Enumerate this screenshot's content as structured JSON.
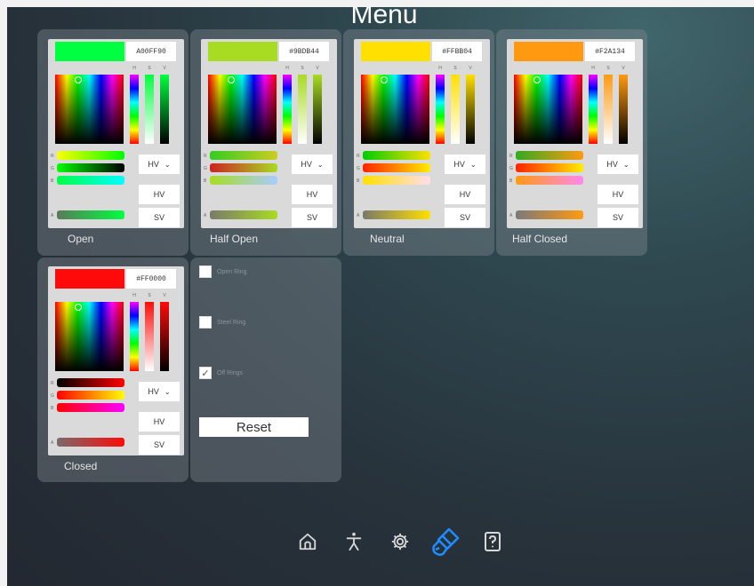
{
  "window": {
    "title": "Menu"
  },
  "pickers": [
    {
      "label": "Open",
      "hex": "A00FF90",
      "color": "#00ff40",
      "vmid": "#00ff40",
      "r_bar": [
        "#ffff00",
        "#00ff00"
      ],
      "g_bar": [
        "#00ff00",
        "#000000"
      ],
      "b_bar": [
        "#00ff44",
        "#00ffff"
      ],
      "a_bar": [
        "#5a7a5a",
        "#00ff40"
      ],
      "mode": "HV",
      "btn1": "HV",
      "btn2": "SV"
    },
    {
      "label": "Half Open",
      "hex": "#9BDB44",
      "color": "#a8dc22",
      "vmid": "#a8dc22",
      "r_bar": [
        "#33cc22",
        "#cccc22"
      ],
      "g_bar": [
        "#cc2222",
        "#a8dc22"
      ],
      "b_bar": [
        "#a8dc22",
        "#a8ccff"
      ],
      "a_bar": [
        "#7a7a6a",
        "#a8dc22"
      ],
      "mode": "HV",
      "btn1": "HV",
      "btn2": "SV"
    },
    {
      "label": "Neutral",
      "hex": "#FFBB04",
      "color": "#ffe000",
      "vmid": "#ffe000",
      "r_bar": [
        "#00cc00",
        "#ffe000"
      ],
      "g_bar": [
        "#ff2200",
        "#ffee00"
      ],
      "b_bar": [
        "#ffe000",
        "#ffddee"
      ],
      "a_bar": [
        "#7a7a6a",
        "#ffe000"
      ],
      "mode": "HV",
      "btn1": "HV",
      "btn2": "SV"
    },
    {
      "label": "Half Closed",
      "hex": "#F2A134",
      "color": "#ff9a10",
      "vmid": "#ff9a10",
      "r_bar": [
        "#33aa22",
        "#ff9a10"
      ],
      "g_bar": [
        "#ff2200",
        "#ffee00"
      ],
      "b_bar": [
        "#ff9a10",
        "#ff88ee"
      ],
      "a_bar": [
        "#7a7a7a",
        "#ff9a10"
      ],
      "mode": "HV",
      "btn1": "HV",
      "btn2": "SV"
    },
    {
      "label": "Closed",
      "hex": "#FF0000",
      "color": "#ff0a0a",
      "vmid": "#ff0a0a",
      "r_bar": [
        "#000000",
        "#ff0000"
      ],
      "g_bar": [
        "#ff0000",
        "#ffff00"
      ],
      "b_bar": [
        "#ff0000",
        "#ff00ff"
      ],
      "a_bar": [
        "#7a6a6a",
        "#ff0a0a"
      ],
      "mode": "HV",
      "btn1": "HV",
      "btn2": "SV"
    }
  ],
  "toggles": [
    {
      "label": "Open Ring",
      "checked": false,
      "mark": ""
    },
    {
      "label": "Steel Ring",
      "checked": false,
      "mark": ""
    },
    {
      "label": "Off Rings",
      "checked": true,
      "mark": "✓"
    }
  ],
  "reset_label": "Reset",
  "navbar": {
    "items": [
      {
        "icon": "home-icon",
        "active": false
      },
      {
        "icon": "accessibility-icon",
        "active": false
      },
      {
        "icon": "gear-icon",
        "active": false
      },
      {
        "icon": "paintbrush-icon",
        "active": true
      },
      {
        "icon": "help-icon",
        "active": false
      }
    ],
    "active_color": "#1f8cff",
    "inactive_color": "#d8d8d8"
  }
}
